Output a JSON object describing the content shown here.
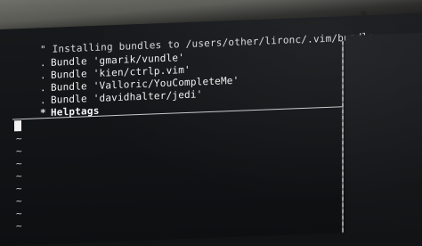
{
  "terminal": {
    "lines": [
      {
        "marker": "",
        "text": "\" Installing bundles to /users/other/lironc/.vim/bundle"
      },
      {
        "marker": ".",
        "text": "Bundle 'gmarik/vundle'"
      },
      {
        "marker": ".",
        "text": "Bundle 'kien/ctrlp.vim'"
      },
      {
        "marker": ".",
        "text": "Bundle 'Valloric/YouCompleteMe'"
      },
      {
        "marker": ".",
        "text": "Bundle 'davidhalter/jedi'"
      },
      {
        "marker": "*",
        "text": "Helptags"
      }
    ],
    "empty_line_marker": "~"
  }
}
